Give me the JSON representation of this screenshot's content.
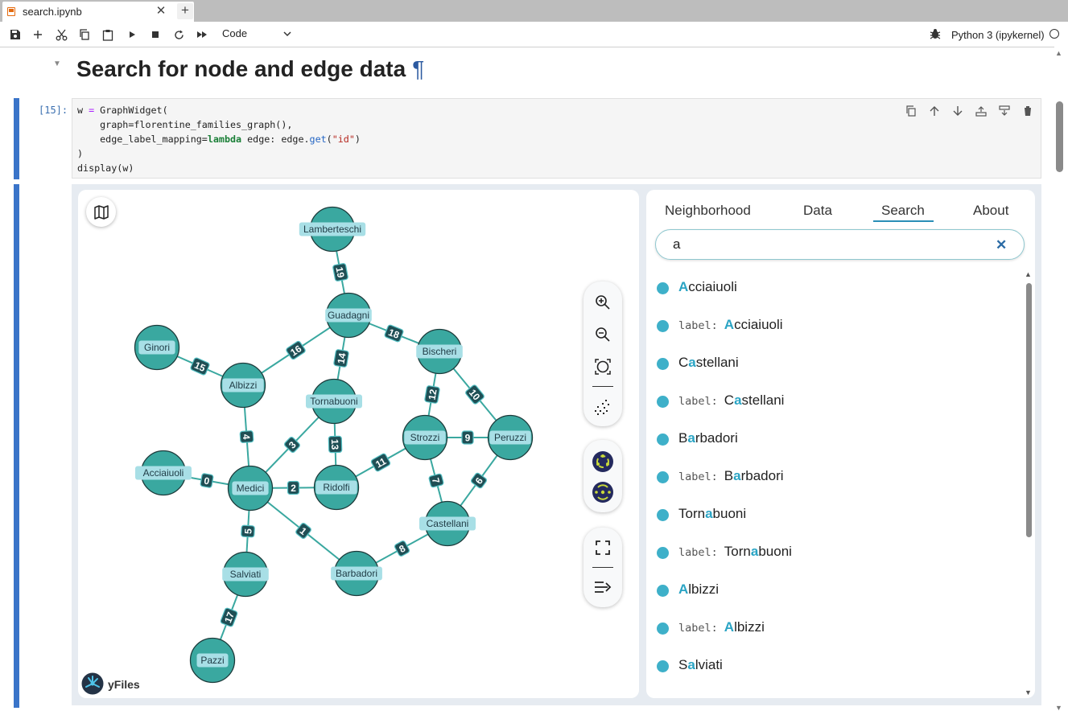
{
  "tab": {
    "title": "search.ipynb",
    "close": "✕",
    "add": "+"
  },
  "toolbar": {
    "cell_type": "Code",
    "kernel": "Python 3 (ipykernel)"
  },
  "markdown": {
    "heading": "Search for node and edge data",
    "anchor": "¶"
  },
  "code_cell": {
    "prompt": "[15]:",
    "lines": [
      "w = GraphWidget(",
      "    graph=florentine_families_graph(),",
      "    edge_label_mapping=lambda edge: edge.get(\"id\")",
      ")",
      "display(w)"
    ]
  },
  "widget": {
    "brand": "yFiles",
    "tabs": [
      "Neighborhood",
      "Data",
      "Search",
      "About"
    ],
    "active_tab": "Search",
    "search_value": "a",
    "results": [
      {
        "label_prefix": "",
        "pre": "",
        "match": "A",
        "post": "cciaiuoli"
      },
      {
        "label_prefix": "label:",
        "pre": "",
        "match": "A",
        "post": "cciaiuoli"
      },
      {
        "label_prefix": "",
        "pre": "C",
        "match": "a",
        "post": "stellani"
      },
      {
        "label_prefix": "label:",
        "pre": "C",
        "match": "a",
        "post": "stellani"
      },
      {
        "label_prefix": "",
        "pre": "B",
        "match": "a",
        "post": "rbadori"
      },
      {
        "label_prefix": "label:",
        "pre": "B",
        "match": "a",
        "post": "rbadori"
      },
      {
        "label_prefix": "",
        "pre": "Torn",
        "match": "a",
        "post": "buoni"
      },
      {
        "label_prefix": "label:",
        "pre": "Torn",
        "match": "a",
        "post": "buoni"
      },
      {
        "label_prefix": "",
        "pre": "",
        "match": "A",
        "post": "lbizzi"
      },
      {
        "label_prefix": "label:",
        "pre": "",
        "match": "A",
        "post": "lbizzi"
      },
      {
        "label_prefix": "",
        "pre": "S",
        "match": "a",
        "post": "lviati"
      }
    ]
  },
  "graph": {
    "nodes": [
      {
        "id": "Lamberteschi"
      },
      {
        "id": "Guadagni"
      },
      {
        "id": "Ginori"
      },
      {
        "id": "Albizzi"
      },
      {
        "id": "Tornabuoni"
      },
      {
        "id": "Bischeri"
      },
      {
        "id": "Strozzi"
      },
      {
        "id": "Peruzzi"
      },
      {
        "id": "Acciaiuoli"
      },
      {
        "id": "Medici"
      },
      {
        "id": "Ridolfi"
      },
      {
        "id": "Castellani"
      },
      {
        "id": "Salviati"
      },
      {
        "id": "Barbadori"
      },
      {
        "id": "Pazzi"
      }
    ],
    "edges": [
      {
        "source": "Lamberteschi",
        "target": "Guadagni",
        "label": "19"
      },
      {
        "source": "Guadagni",
        "target": "Albizzi",
        "label": "16"
      },
      {
        "source": "Guadagni",
        "target": "Tornabuoni",
        "label": "14"
      },
      {
        "source": "Guadagni",
        "target": "Bischeri",
        "label": "18"
      },
      {
        "source": "Ginori",
        "target": "Albizzi",
        "label": "15"
      },
      {
        "source": "Albizzi",
        "target": "Medici",
        "label": "4"
      },
      {
        "source": "Tornabuoni",
        "target": "Medici",
        "label": "3"
      },
      {
        "source": "Tornabuoni",
        "target": "Ridolfi",
        "label": "13"
      },
      {
        "source": "Bischeri",
        "target": "Strozzi",
        "label": "12"
      },
      {
        "source": "Bischeri",
        "target": "Peruzzi",
        "label": "10"
      },
      {
        "source": "Strozzi",
        "target": "Peruzzi",
        "label": "9"
      },
      {
        "source": "Strozzi",
        "target": "Ridolfi",
        "label": "11"
      },
      {
        "source": "Strozzi",
        "target": "Castellani",
        "label": "7"
      },
      {
        "source": "Peruzzi",
        "target": "Castellani",
        "label": "6"
      },
      {
        "source": "Acciaiuoli",
        "target": "Medici",
        "label": "0"
      },
      {
        "source": "Medici",
        "target": "Ridolfi",
        "label": "2"
      },
      {
        "source": "Medici",
        "target": "Salviati",
        "label": "5"
      },
      {
        "source": "Medici",
        "target": "Barbadori",
        "label": "1"
      },
      {
        "source": "Barbadori",
        "target": "Castellani",
        "label": "8"
      },
      {
        "source": "Salviati",
        "target": "Pazzi",
        "label": "17"
      }
    ]
  }
}
